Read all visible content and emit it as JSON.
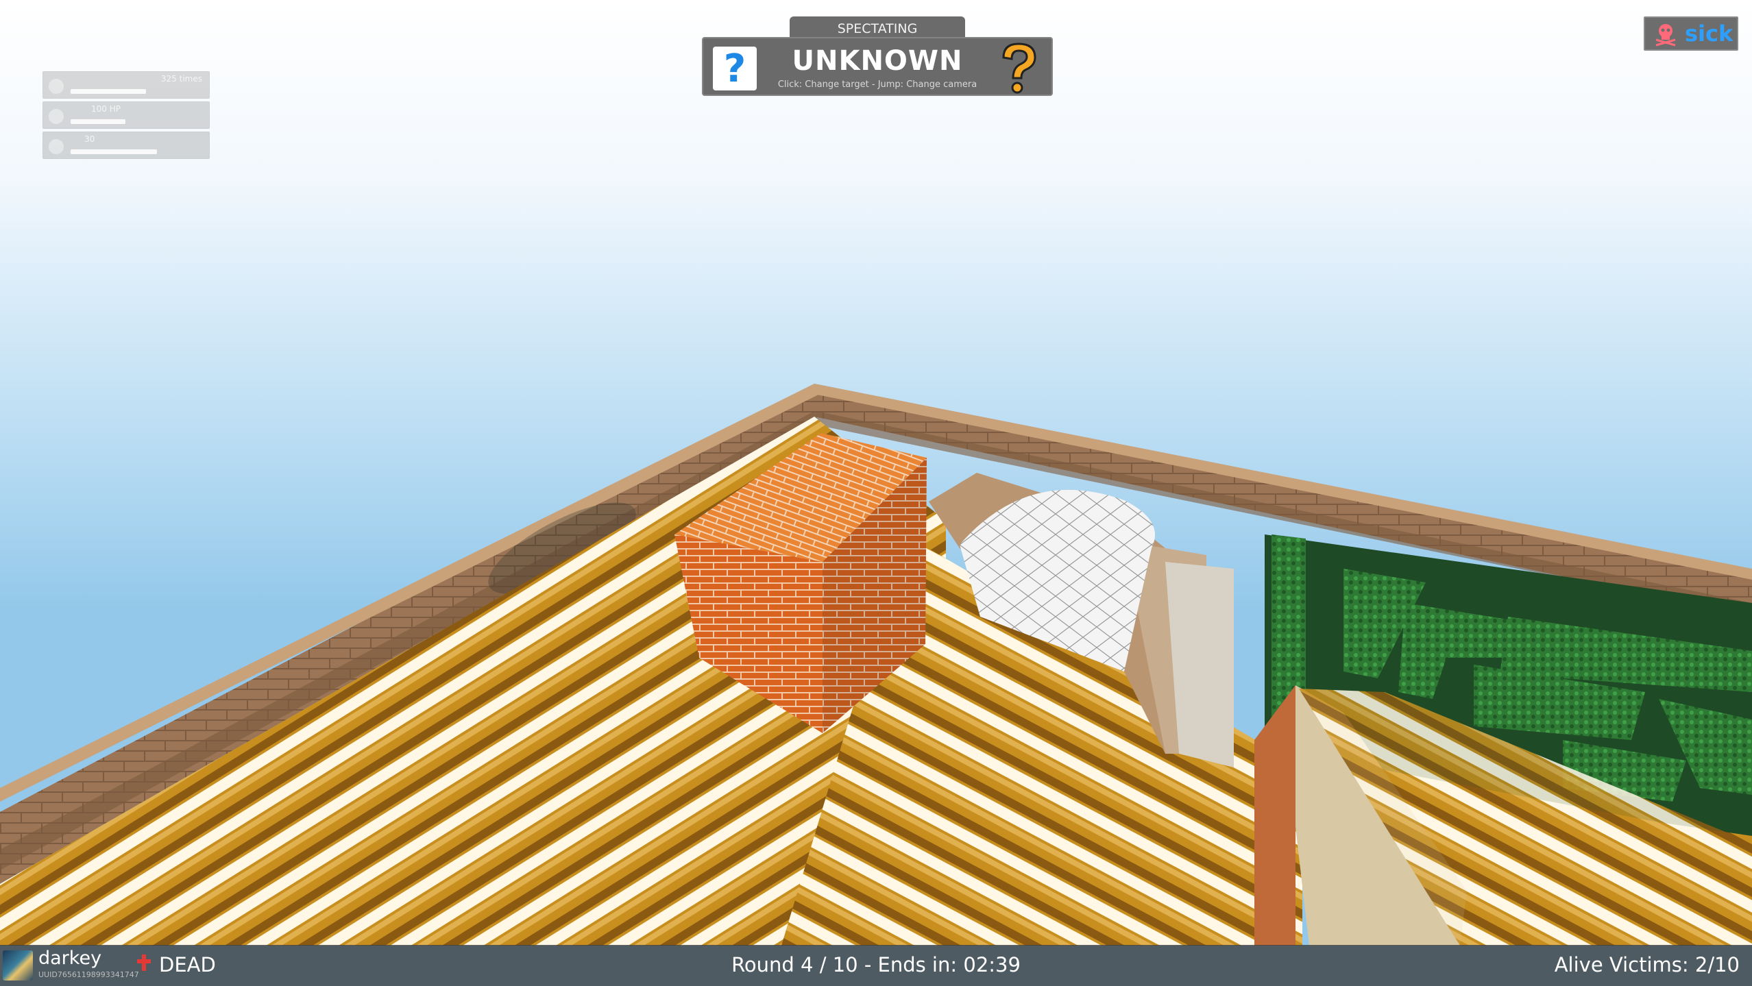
{
  "spectate": {
    "header": "SPECTATING",
    "target_name": "UNKNOWN",
    "hint": "Click: Change target - Jump: Change camera",
    "left_icon_glyph": "?"
  },
  "badge": {
    "icon": "skull-crossbones-icon",
    "label": "sick"
  },
  "stats": {
    "timer_text": "325 times",
    "health_text": "100 HP",
    "ammo_text": "30"
  },
  "player": {
    "name": "darkey",
    "uuid": "UUID76561198993341747",
    "status": "DEAD"
  },
  "round_info": "Round 4 / 10 - Ends in: 02:39",
  "alive_info": "Alive Victims: 2/10",
  "colors": {
    "hud_panel": "#6a6a6a",
    "badge_text": "#2da0ff",
    "question_accent": "#f5a623",
    "sky_top": "#ffffff",
    "sky_bottom": "#8fc9ec"
  }
}
